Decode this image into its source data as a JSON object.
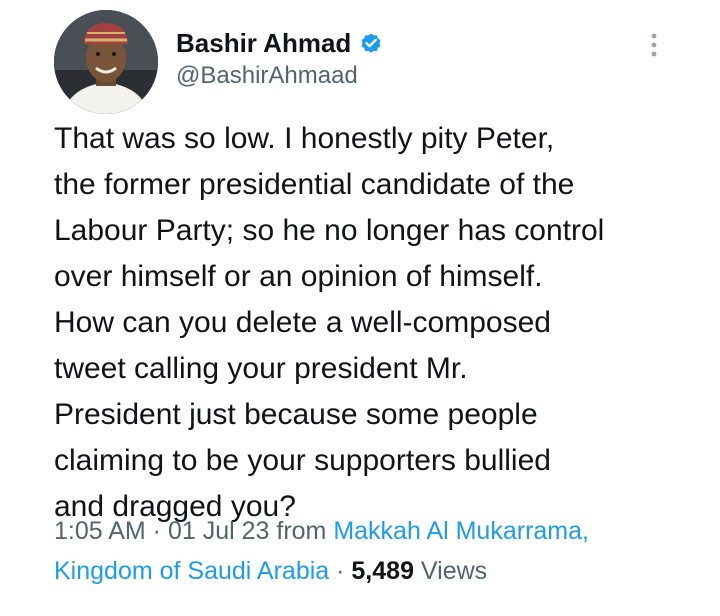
{
  "author": {
    "display_name": "Bashir Ahmad",
    "handle": "@BashirAhmaad",
    "verified": true
  },
  "tweet": {
    "text": "That was so low. I honestly pity Peter,\nthe former presidential candidate of the\nLabour Party; so he no longer has control\nover himself or an opinion of himself.\nHow can you delete a well-composed\ntweet calling your president Mr.\nPresident just because some people\nclaiming to be your supporters bullied\nand dragged you?"
  },
  "meta": {
    "time": "1:05 AM",
    "separator": " · ",
    "date": "01 Jul 23",
    "from_label": " from ",
    "location_line1": "Makkah Al Mukarrama,",
    "location_line2": "Kingdom of Saudi Arabia",
    "views_count": "5,489",
    "views_label": " Views"
  },
  "icons": {
    "verified": "verified-badge-icon",
    "more": "more-options-icon"
  },
  "colors": {
    "accent": "#1d9bf0",
    "text_primary": "#0f1419",
    "text_secondary": "#536471"
  }
}
